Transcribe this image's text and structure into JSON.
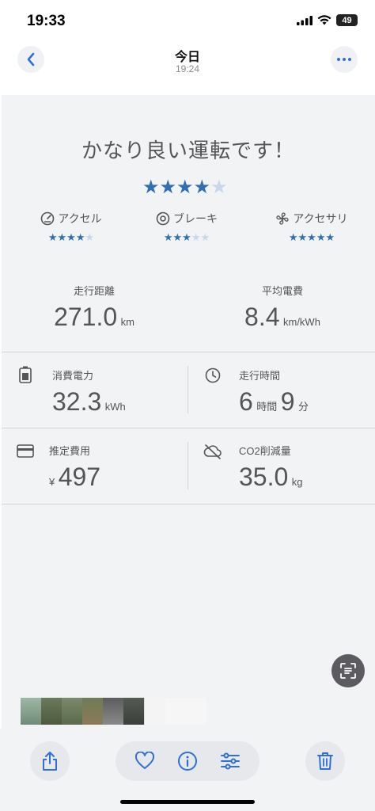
{
  "status": {
    "time": "19:33",
    "battery": "49"
  },
  "nav": {
    "title": "今日",
    "subtitle": "19:24"
  },
  "photo": {
    "headline": "かなり良い運転です！",
    "overall_rating": 4,
    "categories": [
      {
        "label": "アクセル",
        "rating": 4
      },
      {
        "label": "ブレーキ",
        "rating": 3
      },
      {
        "label": "アクセサリ",
        "rating": 5
      }
    ],
    "distance": {
      "label": "走行距離",
      "value": "271.0",
      "unit": "km"
    },
    "efficiency": {
      "label": "平均電費",
      "value": "8.4",
      "unit": "km/kWh"
    },
    "energy": {
      "label": "消費電力",
      "value": "32.3",
      "unit": "kWh"
    },
    "drive_time": {
      "label": "走行時間",
      "hours": "6",
      "hours_unit": "時間",
      "minutes": "9",
      "minutes_unit": "分"
    },
    "cost": {
      "label": "推定費用",
      "currency": "¥",
      "value": "497"
    },
    "co2": {
      "label": "CO2削減量",
      "value": "35.0",
      "unit": "kg"
    }
  },
  "colors": {
    "accent": "#2e6fb5",
    "star_off": "#c8d7ea",
    "background": "#f2f3f5"
  },
  "thumbnails": 9
}
